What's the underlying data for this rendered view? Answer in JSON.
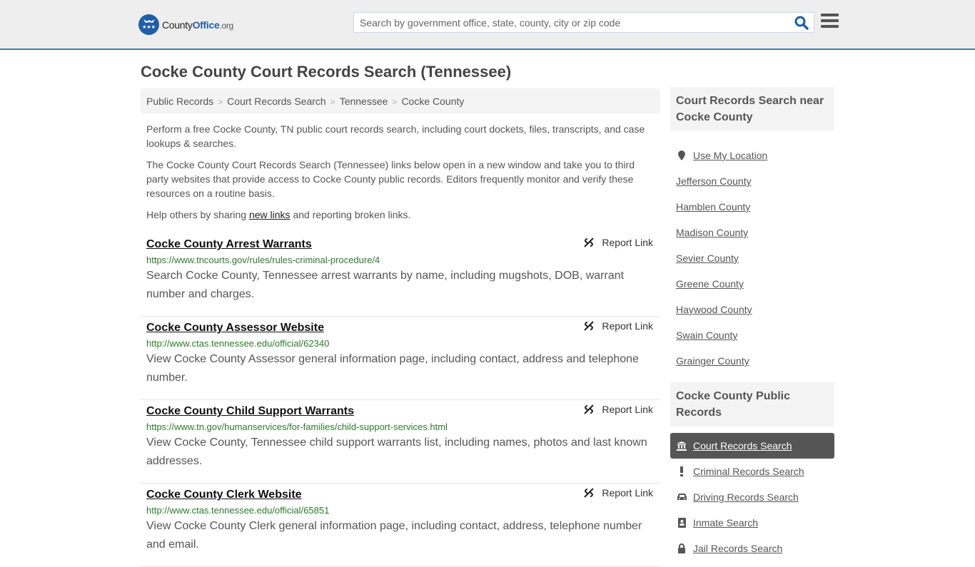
{
  "header": {
    "logo": {
      "county": "County",
      "office": "Office",
      "org": ".org",
      "badge_stars": "★★★"
    },
    "search_placeholder": "Search by government office, state, county, city or zip code",
    "search_value": ""
  },
  "page_title": "Cocke County Court Records Search (Tennessee)",
  "breadcrumb": [
    {
      "label": "Public Records"
    },
    {
      "label": "Court Records Search"
    },
    {
      "label": "Tennessee"
    },
    {
      "label": "Cocke County"
    }
  ],
  "breadcrumb_separator": ">",
  "intro": {
    "p1": "Perform a free Cocke County, TN public court records search, including court dockets, files, transcripts, and case lookups & searches.",
    "p2": "The Cocke County Court Records Search (Tennessee) links below open in a new window and take you to third party websites that provide access to Cocke County public records. Editors frequently monitor and verify these resources on a routine basis.",
    "p3_before": "Help others by sharing ",
    "p3_link": "new links",
    "p3_after": " and reporting broken links."
  },
  "report_label": "Report Link",
  "results": [
    {
      "title": "Cocke County Arrest Warrants",
      "url": "https://www.tncourts.gov/rules/rules-criminal-procedure/4",
      "description": "Search Cocke County, Tennessee arrest warrants by name, including mugshots, DOB, warrant number and charges."
    },
    {
      "title": "Cocke County Assessor Website",
      "url": "http://www.ctas.tennessee.edu/official/62340",
      "description": "View Cocke County Assessor general information page, including contact, address and telephone number."
    },
    {
      "title": "Cocke County Child Support Warrants",
      "url": "https://www.tn.gov/humanservices/for-families/child-support-services.html",
      "description": "View Cocke County, Tennessee child support warrants list, including names, photos and last known addresses."
    },
    {
      "title": "Cocke County Clerk Website",
      "url": "http://www.ctas.tennessee.edu/official/65851",
      "description": "View Cocke County Clerk general information page, including contact, address, telephone number and email."
    }
  ],
  "sidebar": {
    "near_heading": "Court Records Search near Cocke County",
    "use_location": "Use My Location",
    "near_counties": [
      "Jefferson County",
      "Hamblen County",
      "Madison County",
      "Sevier County",
      "Greene County",
      "Haywood County",
      "Swain County",
      "Grainger County"
    ],
    "public_heading": "Cocke County Public Records",
    "public_records": [
      {
        "label": "Court Records Search",
        "icon": "courthouse-icon",
        "active": true
      },
      {
        "label": "Criminal Records Search",
        "icon": "exclamation-icon",
        "active": false
      },
      {
        "label": "Driving Records Search",
        "icon": "car-icon",
        "active": false
      },
      {
        "label": "Inmate Search",
        "icon": "id-badge-icon",
        "active": false
      },
      {
        "label": "Jail Records Search",
        "icon": "lock-icon",
        "active": false
      }
    ]
  },
  "colors": {
    "brand_blue": "#1f5fa8",
    "header_border": "#3f7cae",
    "url_green": "#2d7a2d",
    "active_bg": "#555555"
  }
}
